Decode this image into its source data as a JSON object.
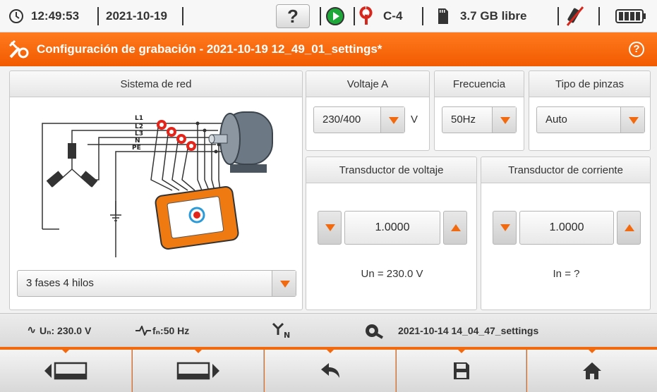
{
  "status": {
    "time": "12:49:53",
    "date": "2021-10-19",
    "help": "?",
    "clamp_id": "C-4",
    "storage": "3.7 GB libre"
  },
  "title": {
    "text": "Configuración de grabación - 2021-10-19 12_49_01_settings*",
    "help": "?"
  },
  "network": {
    "header": "Sistema de red",
    "selected": "3 fases 4 hilos",
    "diagram_labels": [
      "L1",
      "L2",
      "L3",
      "N",
      "PE"
    ]
  },
  "voltage": {
    "header": "Voltaje A",
    "selected": "230/400",
    "unit": "V"
  },
  "frequency": {
    "header": "Frecuencia",
    "selected": "50Hz"
  },
  "clamp_type": {
    "header": "Tipo de pinzas",
    "selected": "Auto"
  },
  "voltage_transducer": {
    "header": "Transductor de voltaje",
    "value": "1.0000",
    "info": "Un = 230.0 V"
  },
  "current_transducer": {
    "header": "Transductor de corriente",
    "value": "1.0000",
    "info": "In = ?"
  },
  "infobar": {
    "un": "Uₙ: 230.0 V",
    "fn": "fₙ:50 Hz",
    "config_file": "2021-10-14 14_04_47_settings"
  },
  "colors": {
    "accent": "#f26a10",
    "title_bg": "#f25a00"
  }
}
